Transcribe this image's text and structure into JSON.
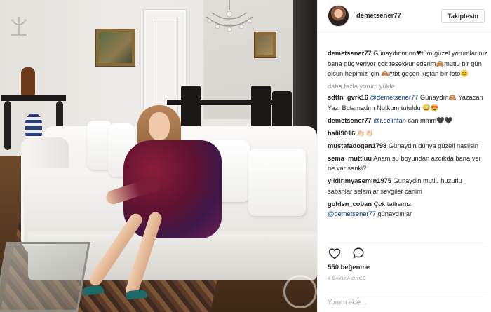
{
  "header": {
    "username": "demetsener77",
    "follow_label": "Takiptesin"
  },
  "caption": {
    "user": "demetsener77",
    "text": "Günaydınnnnn❤tüm güzel yorumlarınız bana güç veriyor çok tesekkur ederim🙈mutlu bir gün olsun hepimiz için 🙈#tbt geçen kıştan bir foto😊"
  },
  "load_more_label": "daha fazla yorum yükle",
  "comments": [
    {
      "user": "sdttn_gvrk16",
      "mention": "@demetsener77",
      "text": " Günaydın🙈 Yazacan Yazı Bulamadım Nutkum tutuldu 😅😍"
    },
    {
      "user": "demetsener77",
      "mention": "@r.selintan",
      "text": " canımmm🖤🖤"
    },
    {
      "user": "halil9016",
      "mention": "",
      "text": "👏🏻👏🏻"
    },
    {
      "user": "mustafadogan1798",
      "mention": "",
      "text": "Günaydin dünya güzeli nasilsin"
    },
    {
      "user": "sema_muttluu",
      "mention": "",
      "text": "Anam şu boyundan azcıkda bana ver ne var sanki?"
    },
    {
      "user": "yildirimyasemin1975",
      "mention": "",
      "text": "Gunaydin mutlu huzurlu sabshlar selamlar sevgiler canim"
    },
    {
      "user": "gulden_coban",
      "mention": "",
      "text": "Çok tatlısınız"
    },
    {
      "user": "",
      "mention": "@demetsener77",
      "text": " günaydınlar"
    }
  ],
  "icons": {
    "like": "heart-icon",
    "comment": "comment-icon"
  },
  "likes_text": "550 beğenme",
  "timestamp": "6 DAKİKA ÖNCE",
  "add_comment_placeholder": "Yorum ekle..."
}
